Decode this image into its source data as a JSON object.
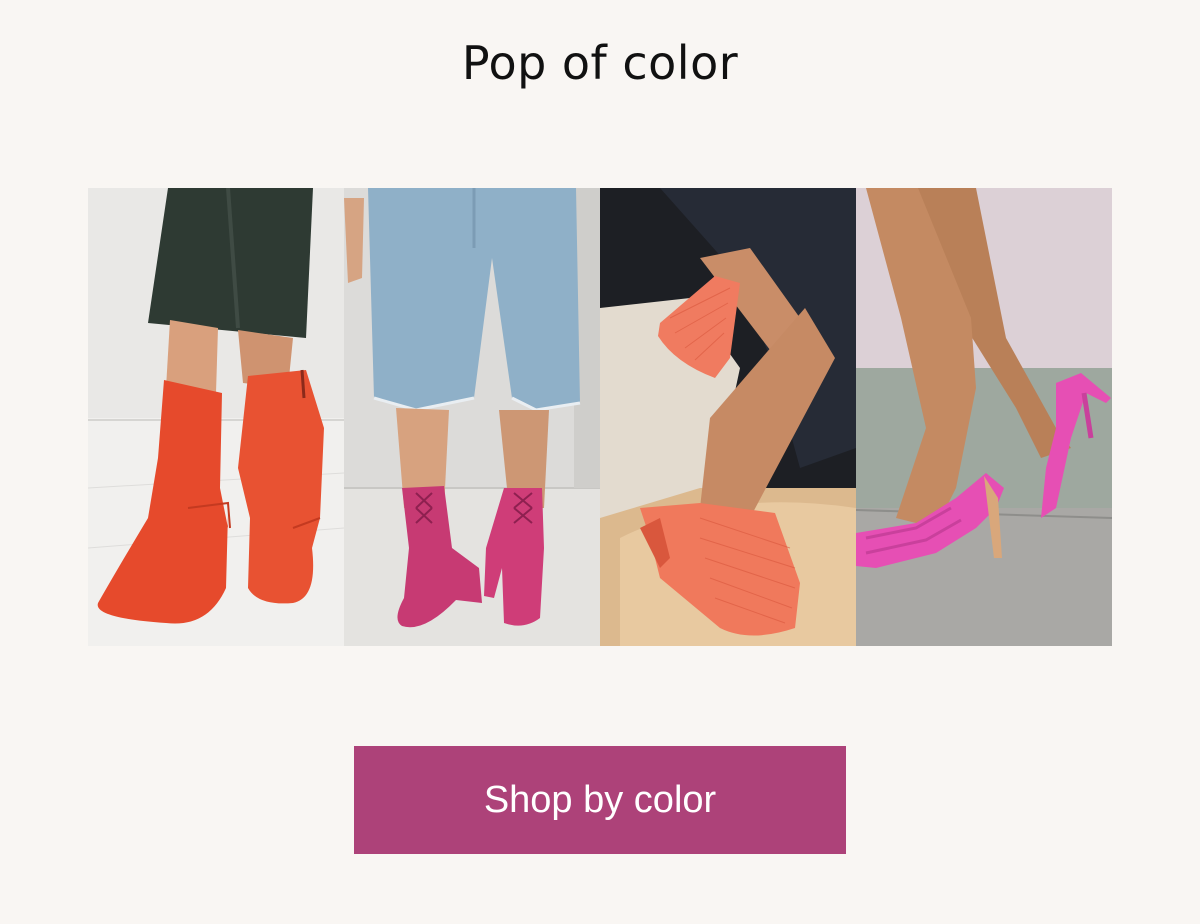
{
  "section": {
    "title": "Pop of color"
  },
  "gallery": {
    "tiles": [
      {
        "icon": "red-ankle-boots-image",
        "shoe_color": "#e64a2c"
      },
      {
        "icon": "pink-lace-up-boots-image",
        "shoe_color": "#cf3d78"
      },
      {
        "icon": "coral-woven-mules-image",
        "shoe_color": "#f0795c"
      },
      {
        "icon": "pink-slingback-heels-image",
        "shoe_color": "#e64fb4"
      }
    ]
  },
  "cta": {
    "label": "Shop by color",
    "color": "#ad4279"
  },
  "colors": {
    "background": "#f9f6f3",
    "title_text": "#111111",
    "button_text": "#ffffff"
  }
}
